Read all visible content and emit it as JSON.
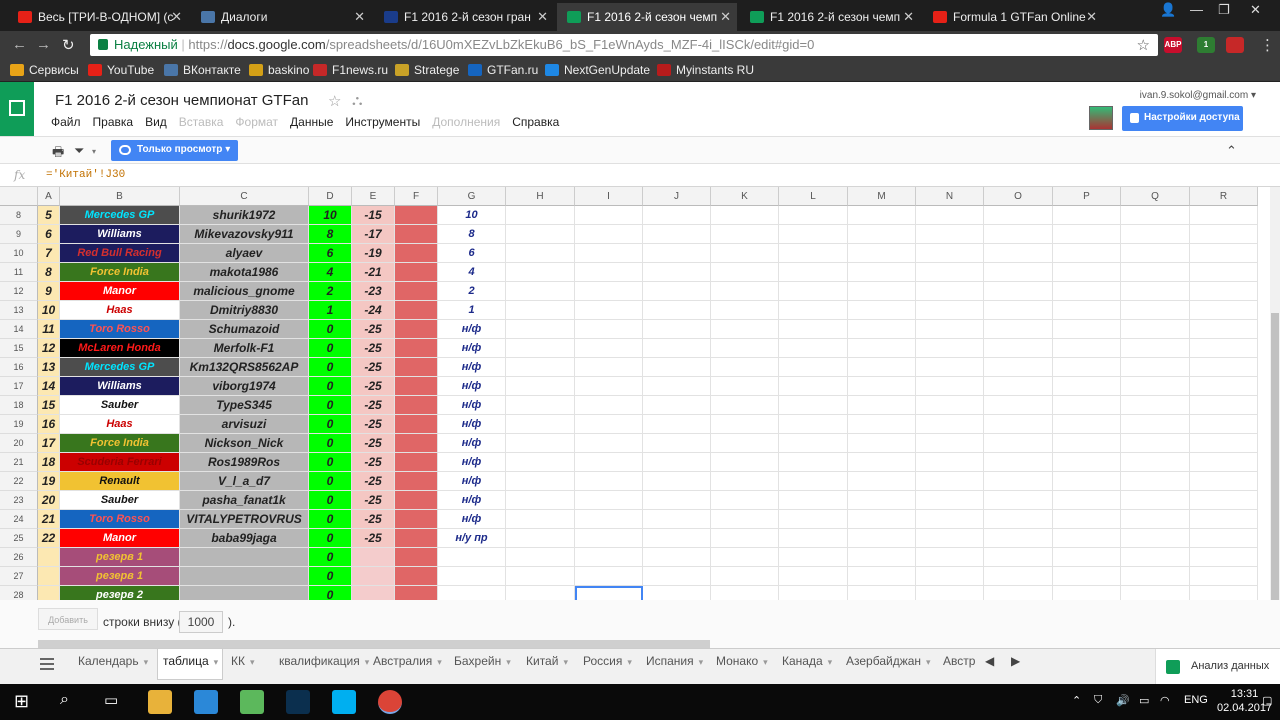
{
  "browser": {
    "tabs": [
      {
        "title": "Весь [ТРИ-В-ОДНОМ] (с",
        "color": "#e62117"
      },
      {
        "title": "Диалоги",
        "color": "#4a76a8"
      },
      {
        "title": "F1 2016 2-й сезон гран",
        "color": "#1a3c8a"
      },
      {
        "title": "F1 2016 2-й сезон чемп",
        "color": "#0f9d58",
        "active": true
      },
      {
        "title": "F1 2016 2-й сезон чемп",
        "color": "#0f9d58"
      },
      {
        "title": "Formula 1 GTFan Online",
        "color": "#e62117"
      }
    ],
    "secure_label": "Надежный",
    "url_prefix": "https://",
    "url_host": "docs.google.com",
    "url_path": "/spreadsheets/d/16U0mXEZvLbZkEkuB6_bS_F1eWnAyds_MZF-4i_lISCk/edit#gid=0",
    "extensions": [
      {
        "label": "ABP",
        "color": "#c70d2c"
      },
      {
        "label": "1",
        "color": "#2e7d32"
      },
      {
        "label": "",
        "color": "#c62828"
      }
    ]
  },
  "bookmarks": [
    {
      "label": "Сервисы",
      "color": "#e8a317"
    },
    {
      "label": "YouTube",
      "color": "#e62117"
    },
    {
      "label": "ВКонтакте",
      "color": "#4a76a8"
    },
    {
      "label": "baskino",
      "color": "#d4a017"
    },
    {
      "label": "F1news.ru",
      "color": "#c62828"
    },
    {
      "label": "Strategе",
      "color": "#c9a227"
    },
    {
      "label": "GTFan.ru",
      "color": "#1565c0"
    },
    {
      "label": "NextGenUpdate",
      "color": "#1e88e5"
    },
    {
      "label": "Myinstants RU",
      "color": "#b71c1c"
    }
  ],
  "doc": {
    "title": "F1 2016 2-й сезон чемпионат GTFan",
    "account": "ivan.9.sokol@gmail.com ▾",
    "share_label": "Настройки доступа",
    "menu": [
      {
        "label": "Файл",
        "disabled": false
      },
      {
        "label": "Правка",
        "disabled": false
      },
      {
        "label": "Вид",
        "disabled": false
      },
      {
        "label": "Вставка",
        "disabled": true
      },
      {
        "label": "Формат",
        "disabled": true
      },
      {
        "label": "Данные",
        "disabled": false
      },
      {
        "label": "Инструменты",
        "disabled": false
      },
      {
        "label": "Дополнения",
        "disabled": true
      },
      {
        "label": "Справка",
        "disabled": false
      }
    ],
    "view_only_label": "Только просмотр ▾"
  },
  "formula_bar": {
    "fx": "fx",
    "formula": "='Китай'!J30"
  },
  "columns": [
    "A",
    "B",
    "C",
    "D",
    "E",
    "F",
    "G",
    "H",
    "I",
    "J",
    "K",
    "L",
    "M",
    "N",
    "O",
    "P",
    "Q",
    "R"
  ],
  "rows": [
    {
      "num": "8",
      "pos": "5",
      "team": "Mercedes GP",
      "team_bg": "#4d4d4d",
      "team_fg": "#00e5ff",
      "driver": "shurik1972",
      "pts": "10",
      "diff": "-15",
      "g": "10"
    },
    {
      "num": "9",
      "pos": "6",
      "team": "Williams",
      "team_bg": "#1c1c5e",
      "team_fg": "#ffffff",
      "driver": "Mikevazovsky911",
      "pts": "8",
      "diff": "-17",
      "g": "8"
    },
    {
      "num": "10",
      "pos": "7",
      "team": "Red Bull Racing",
      "team_bg": "#1c1c5e",
      "team_fg": "#d32f2f",
      "driver": "alyaev",
      "pts": "6",
      "diff": "-19",
      "g": "6"
    },
    {
      "num": "11",
      "pos": "8",
      "team": "Force India",
      "team_bg": "#38761d",
      "team_fg": "#f1c232",
      "driver": "makota1986",
      "pts": "4",
      "diff": "-21",
      "g": "4"
    },
    {
      "num": "12",
      "pos": "9",
      "team": "Manor",
      "team_bg": "#ff0000",
      "team_fg": "#ffffff",
      "driver": "malicious_gnome",
      "pts": "2",
      "diff": "-23",
      "g": "2"
    },
    {
      "num": "13",
      "pos": "10",
      "team": "Haas",
      "team_bg": "#ffffff",
      "team_fg": "#cc0000",
      "driver": "Dmitriy8830",
      "pts": "1",
      "diff": "-24",
      "g": "1"
    },
    {
      "num": "14",
      "pos": "11",
      "team": "Toro Rosso",
      "team_bg": "#1565c0",
      "team_fg": "#ff5252",
      "driver": "Schumazoid",
      "pts": "0",
      "diff": "-25",
      "g": "н/ф"
    },
    {
      "num": "15",
      "pos": "12",
      "team": "McLaren Honda",
      "team_bg": "#000000",
      "team_fg": "#ff1a1a",
      "driver": "Merfolk-F1",
      "pts": "0",
      "diff": "-25",
      "g": "н/ф"
    },
    {
      "num": "16",
      "pos": "13",
      "team": "Mercedes GP",
      "team_bg": "#4d4d4d",
      "team_fg": "#00e5ff",
      "driver": "Km132QRS8562AP",
      "pts": "0",
      "diff": "-25",
      "g": "н/ф"
    },
    {
      "num": "17",
      "pos": "14",
      "team": "Williams",
      "team_bg": "#1c1c5e",
      "team_fg": "#ffffff",
      "driver": "viborg1974",
      "pts": "0",
      "diff": "-25",
      "g": "н/ф"
    },
    {
      "num": "18",
      "pos": "15",
      "team": "Sauber",
      "team_bg": "#ffffff",
      "team_fg": "#111111",
      "driver": "TypeS345",
      "pts": "0",
      "diff": "-25",
      "g": "н/ф"
    },
    {
      "num": "19",
      "pos": "16",
      "team": "Haas",
      "team_bg": "#ffffff",
      "team_fg": "#cc0000",
      "driver": "arvisuzi",
      "pts": "0",
      "diff": "-25",
      "g": "н/ф"
    },
    {
      "num": "20",
      "pos": "17",
      "team": "Force India",
      "team_bg": "#38761d",
      "team_fg": "#f1c232",
      "driver": "Nickson_Nick",
      "pts": "0",
      "diff": "-25",
      "g": "н/ф"
    },
    {
      "num": "21",
      "pos": "18",
      "team": "Scuderia Ferrari",
      "team_bg": "#cc0000",
      "team_fg": "#990000",
      "driver": "Ros1989Ros",
      "pts": "0",
      "diff": "-25",
      "g": "н/ф"
    },
    {
      "num": "22",
      "pos": "19",
      "team": "Renault",
      "team_bg": "#f1c232",
      "team_fg": "#111111",
      "driver": "V_l_a_d7",
      "pts": "0",
      "diff": "-25",
      "g": "н/ф"
    },
    {
      "num": "23",
      "pos": "20",
      "team": "Sauber",
      "team_bg": "#ffffff",
      "team_fg": "#111111",
      "driver": "pasha_fanat1k",
      "pts": "0",
      "diff": "-25",
      "g": "н/ф"
    },
    {
      "num": "24",
      "pos": "21",
      "team": "Toro Rosso",
      "team_bg": "#1565c0",
      "team_fg": "#ff5252",
      "driver": "VITALYPETROVRUS",
      "pts": "0",
      "diff": "-25",
      "g": "н/ф"
    },
    {
      "num": "25",
      "pos": "22",
      "team": "Manor",
      "team_bg": "#ff0000",
      "team_fg": "#ffffff",
      "driver": "baba99jaga",
      "pts": "0",
      "diff": "-25",
      "g": "н/у пр"
    },
    {
      "num": "26",
      "pos": "",
      "team": "резерв 1",
      "team_bg": "#a64d79",
      "team_fg": "#f1c232",
      "driver": "",
      "pts": "0",
      "diff": "",
      "g": ""
    },
    {
      "num": "27",
      "pos": "",
      "team": "резерв 1",
      "team_bg": "#a64d79",
      "team_fg": "#f1c232",
      "driver": "",
      "pts": "0",
      "diff": "",
      "g": ""
    },
    {
      "num": "28",
      "pos": "",
      "team": "резерв 2",
      "team_bg": "#38761d",
      "team_fg": "#ffffff",
      "driver": "",
      "pts": "0",
      "diff": "",
      "g": ""
    }
  ],
  "bottom": {
    "add_button": "Добавить",
    "add_text": "строки внизу (",
    "add_value": "1000",
    "add_close": ")."
  },
  "sheet_tabs": [
    {
      "label": "Календарь",
      "active": false
    },
    {
      "label": "таблица",
      "active": true
    },
    {
      "label": "КК",
      "active": false
    },
    {
      "label": "квалификация",
      "active": false
    },
    {
      "label": "Австралия",
      "active": false
    },
    {
      "label": "Бахрейн",
      "active": false
    },
    {
      "label": "Китай",
      "active": false
    },
    {
      "label": "Россия",
      "active": false
    },
    {
      "label": "Испания",
      "active": false
    },
    {
      "label": "Монако",
      "active": false
    },
    {
      "label": "Канада",
      "active": false
    },
    {
      "label": "Азербайджан",
      "active": false
    },
    {
      "label": "Австр",
      "active": false
    }
  ],
  "explore_label": "Анализ данных",
  "taskbar": {
    "lang": "ENG",
    "time": "13:31",
    "date": "02.04.2017",
    "apps": [
      {
        "name": "explorer",
        "color": "#e8b23a"
      },
      {
        "name": "browser-swirl",
        "color": "#2b88d8"
      },
      {
        "name": "utorrent",
        "color": "#5cb85c"
      },
      {
        "name": "photoshop",
        "color": "#0b2f4e"
      },
      {
        "name": "skype",
        "color": "#00aff0"
      },
      {
        "name": "chrome",
        "color": "#db4437"
      }
    ]
  }
}
